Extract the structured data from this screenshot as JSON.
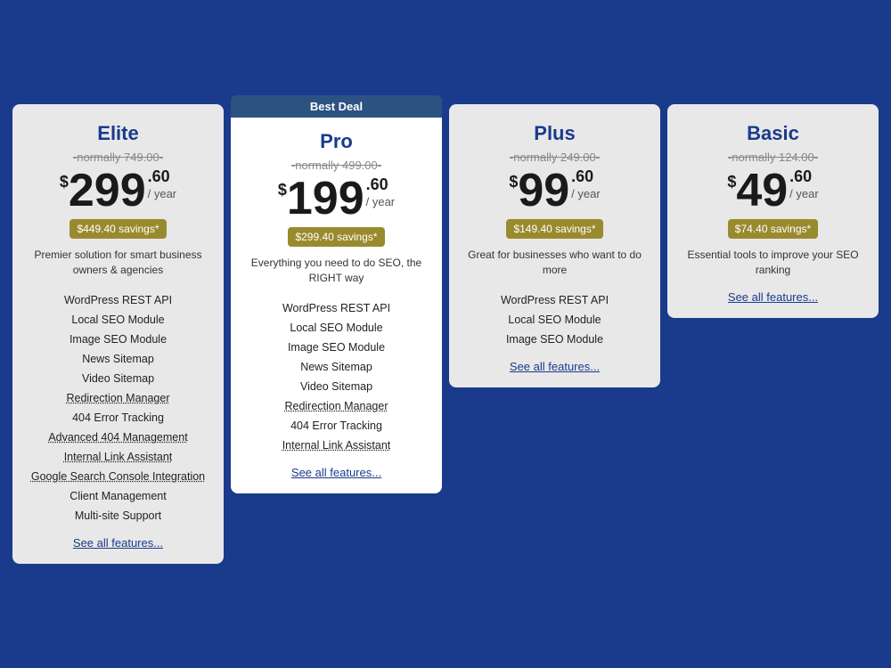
{
  "plans": [
    {
      "id": "elite",
      "name": "Elite",
      "featured": false,
      "best_deal": false,
      "original_price": "normally 749.00",
      "price_dollar": "$",
      "price_main": "299",
      "price_cents": ".60",
      "price_period": "/ year",
      "savings": "$449.40 savings*",
      "description": "Premier solution for smart business owners & agencies",
      "features": [
        {
          "label": "WordPress REST API",
          "underlined": false
        },
        {
          "label": "Local SEO Module",
          "underlined": false
        },
        {
          "label": "Image SEO Module",
          "underlined": false
        },
        {
          "label": "News Sitemap",
          "underlined": false
        },
        {
          "label": "Video Sitemap",
          "underlined": false
        },
        {
          "label": "Redirection Manager",
          "underlined": true
        },
        {
          "label": "404 Error Tracking",
          "underlined": false
        },
        {
          "label": "Advanced 404 Management",
          "underlined": true
        },
        {
          "label": "Internal Link Assistant",
          "underlined": true
        },
        {
          "label": "Google Search Console Integration",
          "underlined": true
        },
        {
          "label": "Client Management",
          "underlined": false
        },
        {
          "label": "Multi-site Support",
          "underlined": false
        }
      ],
      "see_all_label": "See all features..."
    },
    {
      "id": "pro",
      "name": "Pro",
      "featured": true,
      "best_deal": true,
      "best_deal_label": "Best Deal",
      "original_price": "normally 499.00",
      "price_dollar": "$",
      "price_main": "199",
      "price_cents": ".60",
      "price_period": "/ year",
      "savings": "$299.40 savings*",
      "description": "Everything you need to do SEO, the RIGHT way",
      "features": [
        {
          "label": "WordPress REST API",
          "underlined": false
        },
        {
          "label": "Local SEO Module",
          "underlined": false
        },
        {
          "label": "Image SEO Module",
          "underlined": false
        },
        {
          "label": "News Sitemap",
          "underlined": false
        },
        {
          "label": "Video Sitemap",
          "underlined": false
        },
        {
          "label": "Redirection Manager",
          "underlined": true
        },
        {
          "label": "404 Error Tracking",
          "underlined": false
        },
        {
          "label": "Internal Link Assistant",
          "underlined": true
        }
      ],
      "see_all_label": "See all features..."
    },
    {
      "id": "plus",
      "name": "Plus",
      "featured": false,
      "best_deal": false,
      "original_price": "normally 249.00",
      "price_dollar": "$",
      "price_main": "99",
      "price_cents": ".60",
      "price_period": "/ year",
      "savings": "$149.40 savings*",
      "description": "Great for businesses who want to do more",
      "features": [
        {
          "label": "WordPress REST API",
          "underlined": false
        },
        {
          "label": "Local SEO Module",
          "underlined": false
        },
        {
          "label": "Image SEO Module",
          "underlined": false
        }
      ],
      "see_all_label": "See all features..."
    },
    {
      "id": "basic",
      "name": "Basic",
      "featured": false,
      "best_deal": false,
      "original_price": "normally 124.00",
      "price_dollar": "$",
      "price_main": "49",
      "price_cents": ".60",
      "price_period": "/ year",
      "savings": "$74.40 savings*",
      "description": "Essential tools to improve your SEO ranking",
      "features": [],
      "see_all_label": "See all features..."
    }
  ]
}
